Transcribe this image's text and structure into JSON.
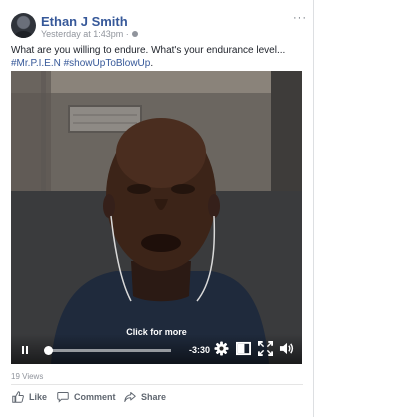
{
  "post": {
    "author": "Ethan J Smith",
    "timestamp": "Yesterday at 1:43pm ·",
    "more_icon": "···",
    "text_plain": "What are you willing to endure. What's your endurance level... ",
    "hashtag_1": "#Mr.P.I.E.N",
    "hashtag_2": "#showUpToBlowUp",
    "text_end": "."
  },
  "video": {
    "click_for_more": "Click for more",
    "remaining_time": "-3:30",
    "progress_fraction": 0.02
  },
  "stats": {
    "views": "19 Views"
  },
  "actions": {
    "like": "Like",
    "comment": "Comment",
    "share": "Share"
  },
  "colors": {
    "link": "#365899",
    "meta": "#90949c",
    "fb_blue": "#4267b2"
  },
  "icons": {
    "avatar": "profile-avatar",
    "privacy": "globe-icon",
    "pause": "pause-icon",
    "settings": "gear-icon",
    "pip": "picture-in-picture-icon",
    "fullscreen": "fullscreen-icon",
    "volume": "volume-icon",
    "like": "thumbs-up-icon",
    "comment": "comment-icon",
    "share": "share-arrow-icon"
  }
}
